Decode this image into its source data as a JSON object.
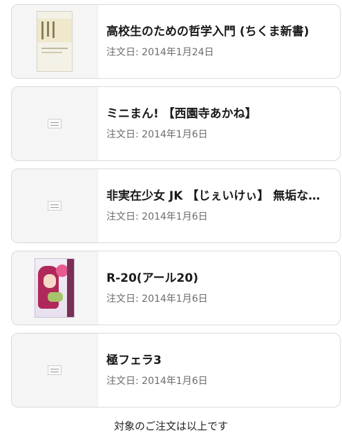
{
  "orders": [
    {
      "title": "高校生のための哲学入門 (ちくま新書)",
      "date": "注文日: 2014年1月24日",
      "thumbnail": "book-cover"
    },
    {
      "title": "ミニまん! 【西園寺あかね】",
      "date": "注文日: 2014年1月6日",
      "thumbnail": "no-image"
    },
    {
      "title": "非実在少女 JK 【じぇいけぃ】 無垢な…",
      "date": "注文日: 2014年1月6日",
      "thumbnail": "no-image"
    },
    {
      "title": "R-20(アール20)",
      "date": "注文日: 2014年1月6日",
      "thumbnail": "product-box"
    },
    {
      "title": "極フェラ3",
      "date": "注文日: 2014年1月6日",
      "thumbnail": "no-image"
    }
  ],
  "footer": {
    "end_message": "対象のご注文は以上です"
  }
}
